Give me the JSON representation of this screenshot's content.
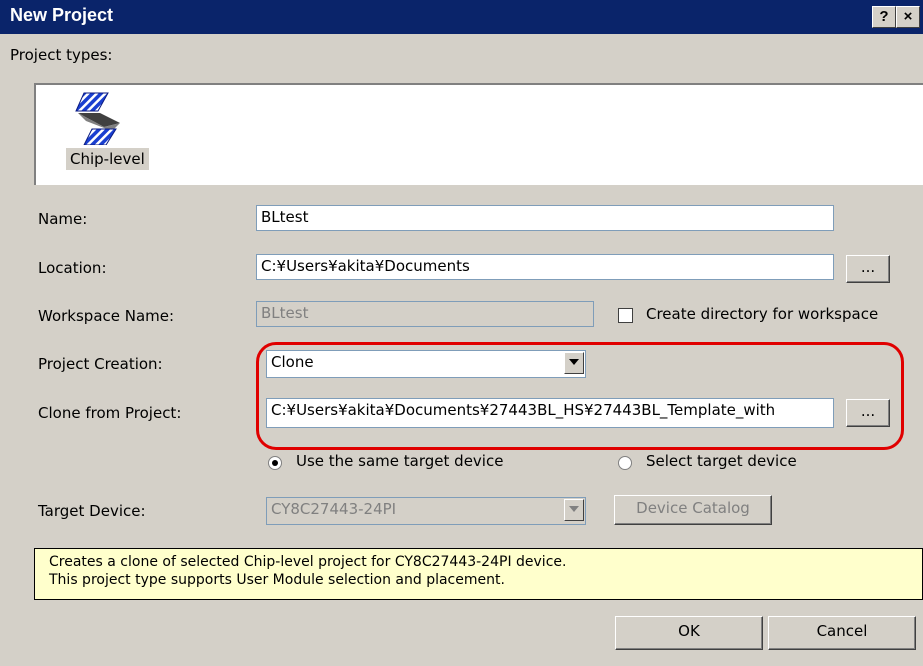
{
  "window": {
    "title": "New Project",
    "help_button": "?",
    "close_button": "×"
  },
  "project_types": {
    "label": "Project types:",
    "items": [
      {
        "label": "Chip-level",
        "icon": "chip-level-icon"
      }
    ]
  },
  "form": {
    "name": {
      "label": "Name:",
      "value": "BLtest"
    },
    "location": {
      "label": "Location:",
      "value": "C:¥Users¥akita¥Documents",
      "browse_label": "..."
    },
    "workspace": {
      "label": "Workspace Name:",
      "value": "BLtest",
      "checkbox_label": "Create directory for workspace"
    },
    "project_creation": {
      "label": "Project Creation:",
      "value": "Clone"
    },
    "clone_from": {
      "label": "Clone from Project:",
      "value": "C:¥Users¥akita¥Documents¥27443BL_HS¥27443BL_Template_with",
      "browse_label": "..."
    },
    "target_options": {
      "same_label": "Use the same target device",
      "select_label": "Select target device",
      "selected": "same"
    },
    "target_device": {
      "label": "Target Device:",
      "value": "CY8C27443-24PI",
      "catalog_label": "Device Catalog"
    }
  },
  "description": {
    "line1": "Creates a clone of selected Chip-level project for CY8C27443-24PI device.",
    "line2": "This project type supports User Module selection and placement."
  },
  "buttons": {
    "ok": "OK",
    "cancel": "Cancel"
  },
  "colors": {
    "titlebar": "#0a246a",
    "dialog_bg": "#d4d0c8",
    "highlight": "#e00000",
    "description_bg": "#ffffcc"
  }
}
